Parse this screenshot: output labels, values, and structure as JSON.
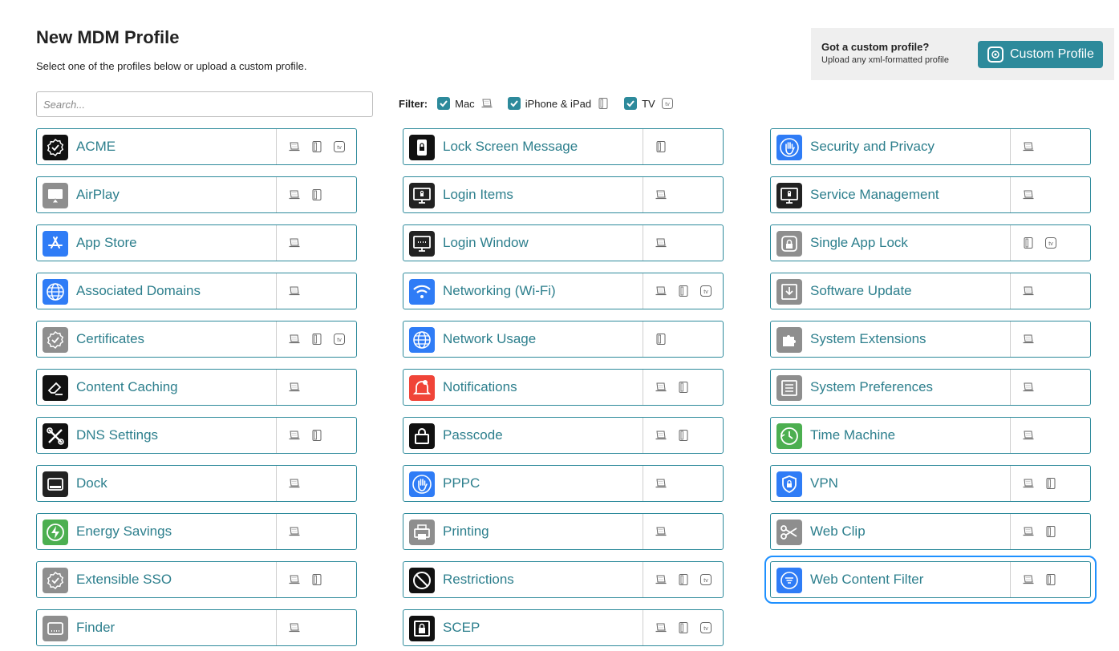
{
  "header": {
    "title": "New MDM Profile",
    "subtitle": "Select one of the profiles below or upload a custom profile."
  },
  "custom_profile": {
    "heading": "Got a custom profile?",
    "sub": "Upload any xml-formatted profile",
    "button_label": "Custom Profile"
  },
  "search": {
    "placeholder": "Search...",
    "value": ""
  },
  "filter": {
    "label": "Filter:",
    "options": [
      {
        "label": "Mac",
        "checked": true,
        "icon": "laptop-icon"
      },
      {
        "label": "iPhone & iPad",
        "checked": true,
        "icon": "phone-icon"
      },
      {
        "label": "TV",
        "checked": true,
        "icon": "tv-icon"
      }
    ]
  },
  "colors": {
    "accent": "#2d8a9b",
    "accent_text": "#2d7f8d",
    "selected_outline": "#1e90ff"
  },
  "columns": [
    [
      {
        "name": "ACME",
        "icon": "badge-check-icon",
        "icon_bg": "#111111",
        "platforms": [
          "mac",
          "ios",
          "tv"
        ]
      },
      {
        "name": "AirPlay",
        "icon": "airplay-icon",
        "icon_bg": "#8e8e8e",
        "platforms": [
          "mac",
          "ios"
        ]
      },
      {
        "name": "App Store",
        "icon": "app-store-icon",
        "icon_bg": "#2f7cf6",
        "platforms": [
          "mac"
        ]
      },
      {
        "name": "Associated Domains",
        "icon": "globe-icon",
        "icon_bg": "#2f7cf6",
        "platforms": [
          "mac"
        ]
      },
      {
        "name": "Certificates",
        "icon": "certificate-icon",
        "icon_bg": "#8e8e8e",
        "platforms": [
          "mac",
          "ios",
          "tv"
        ]
      },
      {
        "name": "Content Caching",
        "icon": "eraser-icon",
        "icon_bg": "#111111",
        "platforms": [
          "mac"
        ]
      },
      {
        "name": "DNS Settings",
        "icon": "tools-icon",
        "icon_bg": "#111111",
        "platforms": [
          "mac",
          "ios"
        ]
      },
      {
        "name": "Dock",
        "icon": "dock-icon",
        "icon_bg": "#222222",
        "platforms": [
          "mac"
        ]
      },
      {
        "name": "Energy Savings",
        "icon": "bolt-icon",
        "icon_bg": "#4caf50",
        "platforms": [
          "mac"
        ]
      },
      {
        "name": "Extensible SSO",
        "icon": "certificate-icon",
        "icon_bg": "#8e8e8e",
        "platforms": [
          "mac",
          "ios"
        ]
      },
      {
        "name": "Finder",
        "icon": "finder-icon",
        "icon_bg": "#8e8e8e",
        "platforms": [
          "mac"
        ]
      }
    ],
    [
      {
        "name": "Lock Screen Message",
        "icon": "lock-phone-icon",
        "icon_bg": "#111111",
        "platforms": [
          "ios"
        ]
      },
      {
        "name": "Login Items",
        "icon": "monitor-lock-icon",
        "icon_bg": "#222222",
        "platforms": [
          "mac"
        ]
      },
      {
        "name": "Login Window",
        "icon": "monitor-dots-icon",
        "icon_bg": "#222222",
        "platforms": [
          "mac"
        ]
      },
      {
        "name": "Networking (Wi-Fi)",
        "icon": "wifi-icon",
        "icon_bg": "#2f7cf6",
        "platforms": [
          "mac",
          "ios",
          "tv"
        ]
      },
      {
        "name": "Network Usage",
        "icon": "globe-icon",
        "icon_bg": "#2f7cf6",
        "platforms": [
          "ios"
        ]
      },
      {
        "name": "Notifications",
        "icon": "bell-icon",
        "icon_bg": "#f04438",
        "platforms": [
          "mac",
          "ios"
        ]
      },
      {
        "name": "Passcode",
        "icon": "padlock-icon",
        "icon_bg": "#111111",
        "platforms": [
          "mac",
          "ios"
        ]
      },
      {
        "name": "PPPC",
        "icon": "hand-icon",
        "icon_bg": "#2f7cf6",
        "platforms": [
          "mac"
        ]
      },
      {
        "name": "Printing",
        "icon": "printer-icon",
        "icon_bg": "#8e8e8e",
        "platforms": [
          "mac"
        ]
      },
      {
        "name": "Restrictions",
        "icon": "prohibited-icon",
        "icon_bg": "#111111",
        "platforms": [
          "mac",
          "ios",
          "tv"
        ]
      },
      {
        "name": "SCEP",
        "icon": "padlock-box-icon",
        "icon_bg": "#111111",
        "platforms": [
          "mac",
          "ios",
          "tv"
        ]
      }
    ],
    [
      {
        "name": "Security and Privacy",
        "icon": "hand-icon",
        "icon_bg": "#2f7cf6",
        "platforms": [
          "mac"
        ]
      },
      {
        "name": "Service Management",
        "icon": "monitor-lock-icon",
        "icon_bg": "#222222",
        "platforms": [
          "mac"
        ]
      },
      {
        "name": "Single App Lock",
        "icon": "app-lock-icon",
        "icon_bg": "#8e8e8e",
        "platforms": [
          "ios",
          "tv"
        ]
      },
      {
        "name": "Software Update",
        "icon": "download-icon",
        "icon_bg": "#8e8e8e",
        "platforms": [
          "mac"
        ]
      },
      {
        "name": "System Extensions",
        "icon": "puzzle-icon",
        "icon_bg": "#8e8e8e",
        "platforms": [
          "mac"
        ]
      },
      {
        "name": "System Preferences",
        "icon": "list-icon",
        "icon_bg": "#8e8e8e",
        "platforms": [
          "mac"
        ]
      },
      {
        "name": "Time Machine",
        "icon": "clock-icon",
        "icon_bg": "#4caf50",
        "platforms": [
          "mac"
        ]
      },
      {
        "name": "VPN",
        "icon": "shield-lock-icon",
        "icon_bg": "#2f7cf6",
        "platforms": [
          "mac",
          "ios"
        ]
      },
      {
        "name": "Web Clip",
        "icon": "scissors-icon",
        "icon_bg": "#8e8e8e",
        "platforms": [
          "mac",
          "ios"
        ]
      },
      {
        "name": "Web Content Filter",
        "icon": "filter-icon",
        "icon_bg": "#2f7cf6",
        "platforms": [
          "mac",
          "ios"
        ],
        "selected": true
      }
    ]
  ]
}
